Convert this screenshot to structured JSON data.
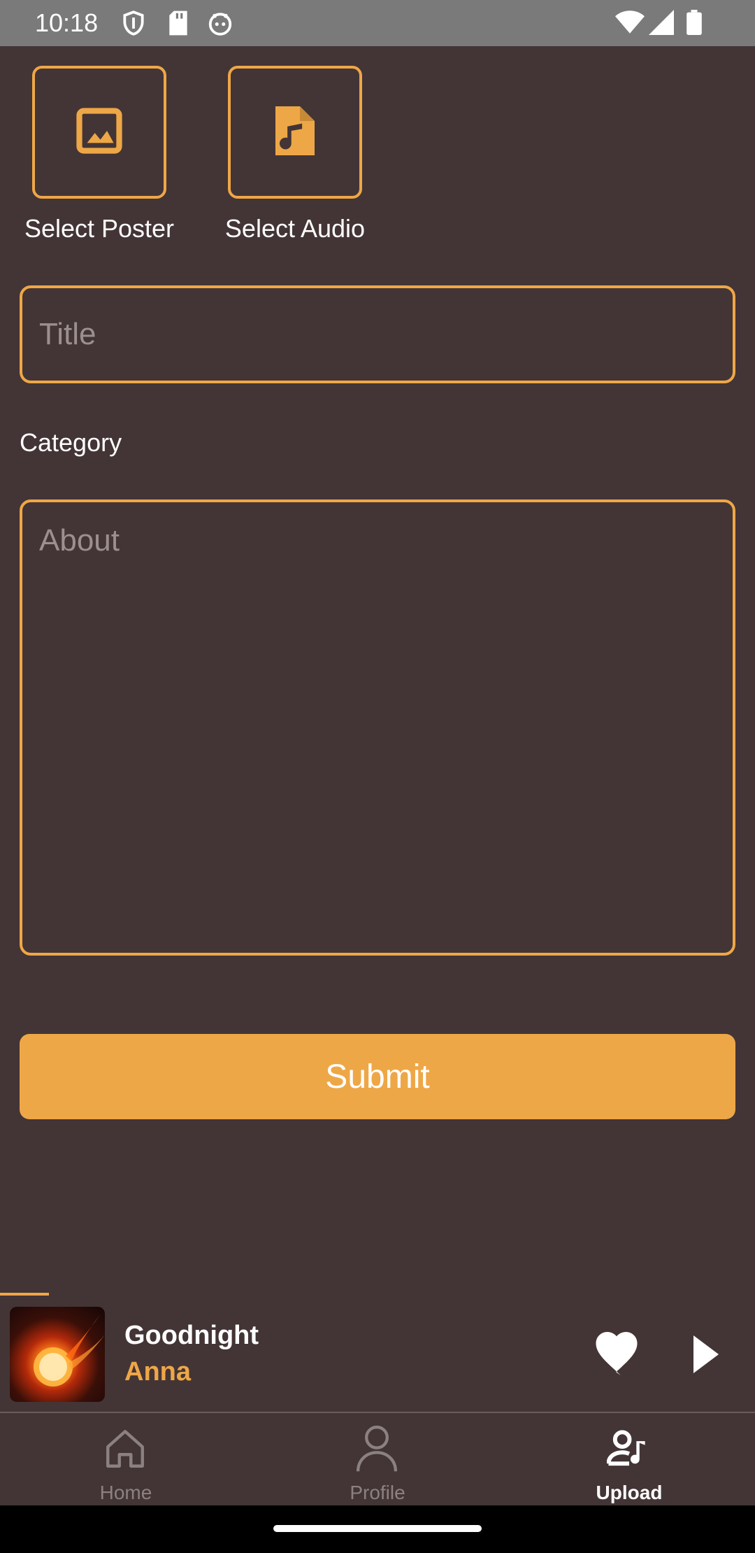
{
  "status_bar": {
    "time": "10:18",
    "left_icons": [
      "shield-icon",
      "sd-card-icon",
      "android-icon"
    ],
    "right_icons": [
      "wifi-icon",
      "signal-icon",
      "battery-icon"
    ]
  },
  "pickers": {
    "poster_label": "Select Poster",
    "audio_label": "Select Audio"
  },
  "form": {
    "title_placeholder": "Title",
    "category_label": "Category",
    "about_placeholder": "About",
    "submit_label": "Submit"
  },
  "player": {
    "track_title": "Goodnight",
    "artist": "Anna",
    "progress": 0.065
  },
  "nav": {
    "items": [
      {
        "label": "Home",
        "icon": "home-icon",
        "active": false
      },
      {
        "label": "Profile",
        "icon": "person-icon",
        "active": false
      },
      {
        "label": "Upload",
        "icon": "upload-music-icon",
        "active": true
      }
    ]
  },
  "colors": {
    "background": "#433536",
    "accent": "#eea747",
    "status_bar": "#7a7a7a"
  }
}
